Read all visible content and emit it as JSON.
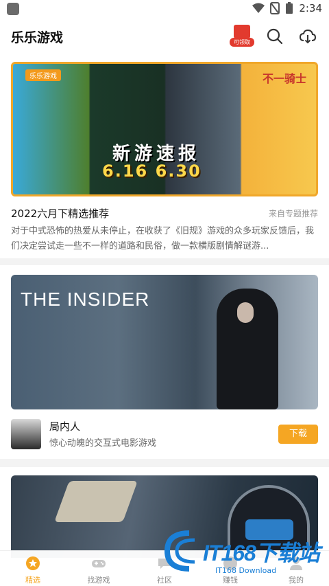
{
  "status_bar": {
    "time": "2:34"
  },
  "header": {
    "title": "乐乐游戏",
    "gift_label": "可领取"
  },
  "featured": {
    "banner": {
      "logo_text": "乐乐游戏",
      "caption": "新游速报",
      "dates": "6.16  6.30",
      "right_title": "不一骑士"
    },
    "title": "2022六月下精选推荐",
    "source": "来自专题推荐",
    "description": "对于中式恐怖的热爱从未停止，在收获了《旧规》游戏的众多玩家反馈后，我们决定尝试走一些不一样的道路和民俗，做一款横版剧情解谜游..."
  },
  "game_card": {
    "poster_title": "THE INSIDER",
    "name": "局内人",
    "description": "惊心动魄的交互式电影游戏",
    "download_label": "下载"
  },
  "tabs": [
    {
      "label": "精选",
      "icon": "star-icon",
      "active": true
    },
    {
      "label": "找游戏",
      "icon": "gamepad-icon",
      "active": false
    },
    {
      "label": "社区",
      "icon": "community-icon",
      "active": false
    },
    {
      "label": "赚钱",
      "icon": "earn-icon",
      "active": false
    },
    {
      "label": "我的",
      "icon": "profile-icon",
      "active": false
    }
  ],
  "watermark": {
    "brand": "IT168下载站",
    "sub": "IT168 Download"
  },
  "colors": {
    "accent": "#f5a623",
    "gift_red": "#e23a2e",
    "watermark_blue": "#1a7fd6"
  }
}
